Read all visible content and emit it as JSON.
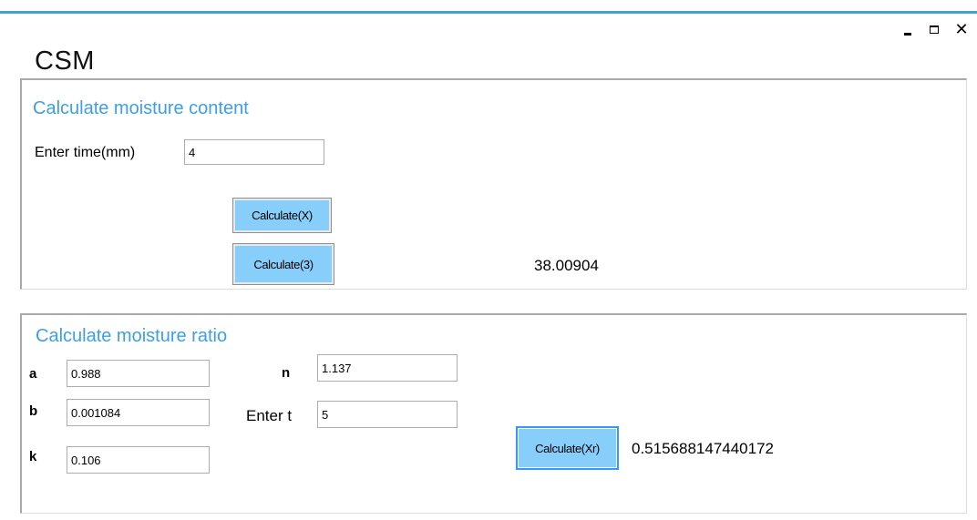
{
  "window": {
    "title": "CSM",
    "controls": {
      "minimize": "minimize-icon",
      "maximize": "maximize-icon",
      "close": "close-icon",
      "close_glyph": "✕"
    },
    "accent_color": "#41a0d6"
  },
  "moisture_content": {
    "heading": "Calculate moisture content",
    "time_label": "Enter time(mm)",
    "time_value": "4",
    "calc_x_label": "Calculate(X)",
    "calc_3_label": "Calculate(3)",
    "result": "38.00904"
  },
  "moisture_ratio": {
    "heading": "Calculate moisture ratio",
    "a_label": "a",
    "a_value": "0.988",
    "b_label": "b",
    "b_value": "0.001084",
    "k_label": "k",
    "k_value": "0.106",
    "n_label": "n",
    "n_value": "1.137",
    "t_label": "Enter t",
    "t_value": "5",
    "calc_xr_label": "Calculate(Xr)",
    "result": "0.515688147440172"
  },
  "colors": {
    "heading": "#3d9fe6",
    "button_fill": "#87cefa",
    "button_focus_border": "#3399ff"
  }
}
